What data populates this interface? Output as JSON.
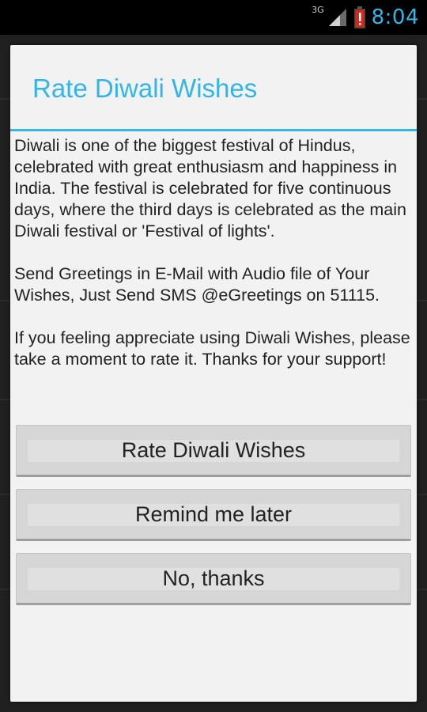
{
  "status_bar": {
    "network_label": "3G",
    "time": "8:04",
    "accent_color": "#33b5e5",
    "battery_alert_color": "#d9261c",
    "icons": [
      "signal-icon",
      "battery-alert-icon"
    ]
  },
  "dialog": {
    "title": "Rate Diwali Wishes",
    "title_color": "#33b5e5",
    "message": {
      "paragraph_1": "Diwali is one of the biggest festival of Hindus, celebrated with great enthusiasm and happiness in India. The festival is celebrated for five continuous days, where the third days is celebrated as the main Diwali festival or 'Festival of lights'.",
      "paragraph_2": "Send Greetings in E-Mail with Audio file of Your Wishes, Just Send SMS @eGreetings on 51115.",
      "paragraph_3": "If you feeling appreciate using Diwali Wishes, please take a moment to rate it. Thanks for your support!"
    },
    "buttons": {
      "rate": "Rate Diwali Wishes",
      "remind": "Remind me later",
      "no_thanks": "No, thanks"
    }
  }
}
